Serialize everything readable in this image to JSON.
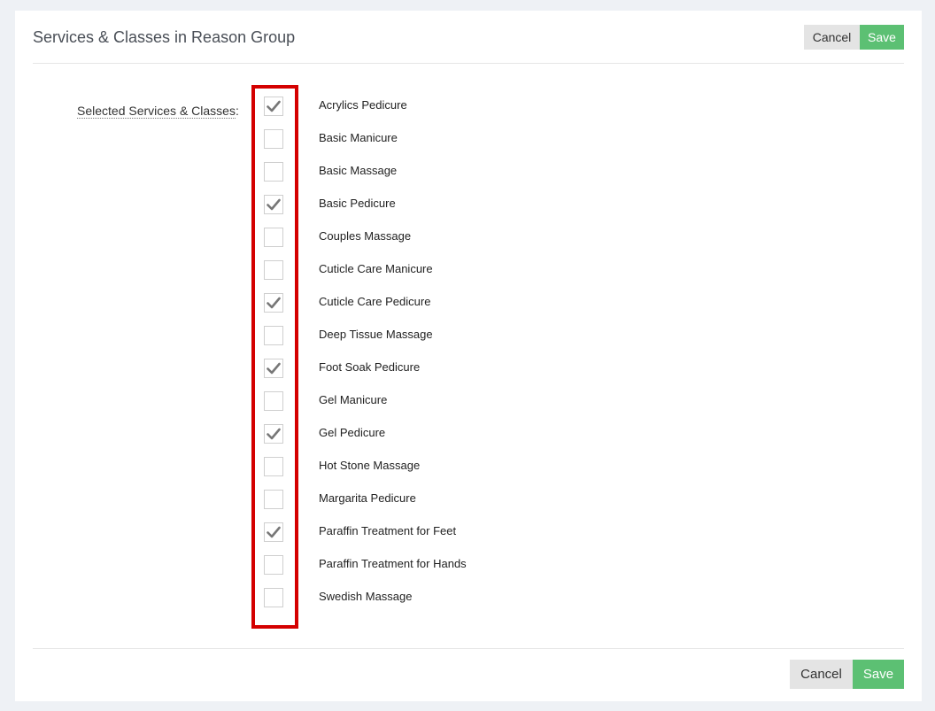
{
  "header": {
    "title": "Services & Classes in Reason Group",
    "cancel_label": "Cancel",
    "save_label": "Save"
  },
  "form": {
    "field_label": "Selected Services & Classes",
    "label_suffix": ":",
    "options": [
      {
        "label": "Acrylics Pedicure",
        "checked": true
      },
      {
        "label": "Basic Manicure",
        "checked": false
      },
      {
        "label": "Basic Massage",
        "checked": false
      },
      {
        "label": "Basic Pedicure",
        "checked": true
      },
      {
        "label": "Couples Massage",
        "checked": false
      },
      {
        "label": "Cuticle Care Manicure",
        "checked": false
      },
      {
        "label": "Cuticle Care Pedicure",
        "checked": true
      },
      {
        "label": "Deep Tissue Massage",
        "checked": false
      },
      {
        "label": "Foot Soak Pedicure",
        "checked": true
      },
      {
        "label": "Gel Manicure",
        "checked": false
      },
      {
        "label": "Gel Pedicure",
        "checked": true
      },
      {
        "label": "Hot Stone Massage",
        "checked": false
      },
      {
        "label": "Margarita Pedicure",
        "checked": false
      },
      {
        "label": "Paraffin Treatment for Feet",
        "checked": true
      },
      {
        "label": "Paraffin Treatment for Hands",
        "checked": false
      },
      {
        "label": "Swedish Massage",
        "checked": false
      }
    ]
  },
  "footer": {
    "cancel_label": "Cancel",
    "save_label": "Save"
  },
  "colors": {
    "save": "#5cc073",
    "cancel": "#e4e4e4",
    "highlight": "#d40000",
    "checkmark": "#777777"
  }
}
